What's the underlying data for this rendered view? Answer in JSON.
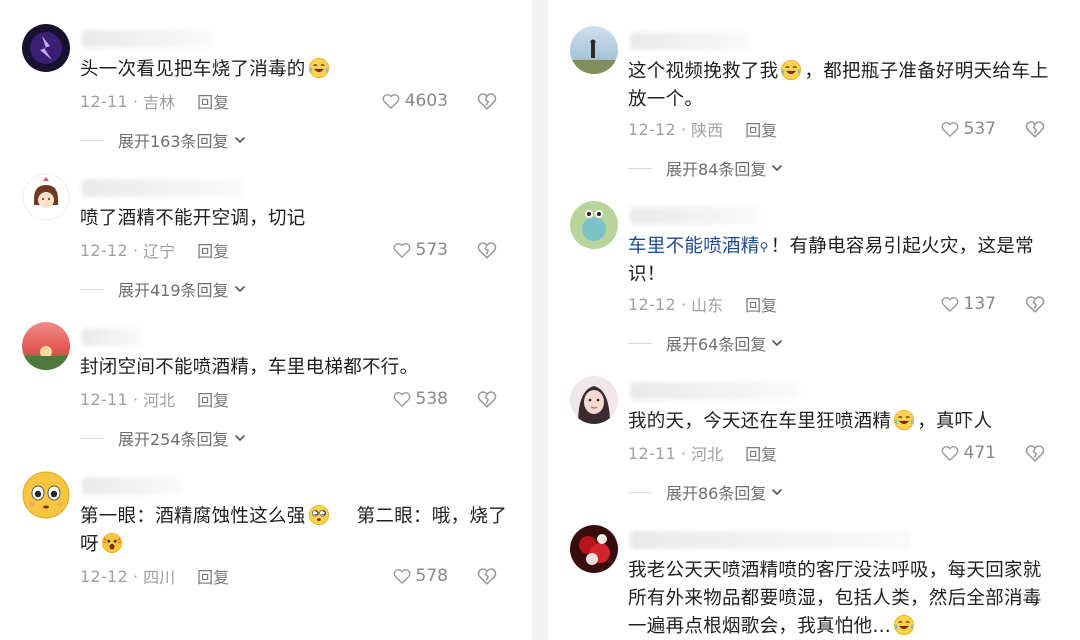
{
  "left_comments": [
    {
      "avatar": "purple-flash-avatar",
      "text": "头一次看见把车烧了消毒的",
      "text_emoji": "crying-laughing-emoji",
      "date": "12-11",
      "location": "吉林",
      "reply_label": "回复",
      "likes": "4603",
      "expand_label": "展开163条回复"
    },
    {
      "avatar": "cartoon-girl-avatar",
      "text": "喷了酒精不能开空调，切记",
      "date": "12-12",
      "location": "辽宁",
      "reply_label": "回复",
      "likes": "573",
      "expand_label": "展开419条回复"
    },
    {
      "avatar": "sunset-avatar",
      "text": "封闭空间不能喷酒精，车里电梯都不行。",
      "date": "12-11",
      "location": "河北",
      "reply_label": "回复",
      "likes": "538",
      "expand_label": "展开254条回复"
    },
    {
      "avatar": "yellow-face-avatar",
      "text_part1": "第一眼：酒精腐蚀性这么强",
      "text_emoji1": "dizzy-eyes-emoji",
      "text_part2": "　 第二眼：哦，烧了呀",
      "text_emoji2": "shocked-emoji",
      "date": "12-12",
      "location": "四川",
      "reply_label": "回复",
      "likes": "578"
    }
  ],
  "right_comments": [
    {
      "avatar": "person-seaside-avatar",
      "text_part1": "这个视频挽救了我",
      "text_emoji": "crying-laughing-emoji",
      "text_part2": "，都把瓶子准备好明天给车上放一个。",
      "date": "12-12",
      "location": "陕西",
      "reply_label": "回复",
      "likes": "537",
      "expand_label": "展开84条回复"
    },
    {
      "avatar": "green-cartoon-avatar",
      "topic": "车里不能喷酒精",
      "text": "！有静电容易引起火灾，这是常识！",
      "date": "12-12",
      "location": "山东",
      "reply_label": "回复",
      "likes": "137",
      "expand_label": "展开64条回复"
    },
    {
      "avatar": "girl-photo-avatar",
      "text_part1": "我的天，今天还在车里狂喷酒精",
      "text_emoji": "crying-laughing-emoji",
      "text_part2": "，真吓人",
      "date": "12-11",
      "location": "河北",
      "reply_label": "回复",
      "likes": "471",
      "expand_label": "展开86条回复"
    },
    {
      "avatar": "red-flower-avatar",
      "text": "我老公天天喷酒精喷的客厅没法呼吸，每天回家就所有外来物品都要喷湿，包括人类，然后全部消毒一遍再点根烟歌会，我真怕他…",
      "text_emoji": "crying-laughing-emoji"
    }
  ],
  "colors": {
    "meta_gray": "#a0a0a0",
    "topic_blue": "#1e4b8f",
    "text": "#1f1f1f"
  }
}
